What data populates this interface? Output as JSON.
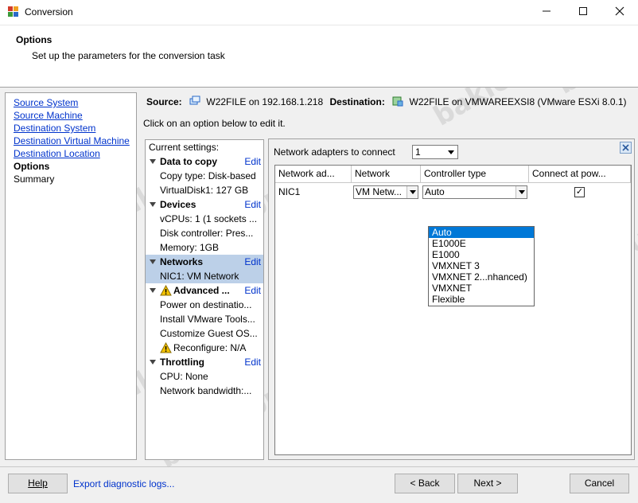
{
  "window": {
    "title": "Conversion"
  },
  "header": {
    "title": "Options",
    "subtitle": "Set up the parameters for the conversion task"
  },
  "nav": {
    "items": [
      {
        "label": "Source System",
        "state": "link"
      },
      {
        "label": "Source Machine",
        "state": "link"
      },
      {
        "label": "Destination System",
        "state": "link"
      },
      {
        "label": "Destination Virtual Machine",
        "state": "link"
      },
      {
        "label": "Destination Location",
        "state": "link"
      },
      {
        "label": "Options",
        "state": "current"
      },
      {
        "label": "Summary",
        "state": "plain"
      }
    ]
  },
  "summary": {
    "source_label": "Source:",
    "source_value": "W22FILE on 192.168.1.218",
    "dest_label": "Destination:",
    "dest_value": "W22FILE on VMWAREEXSI8 (VMware ESXi 8.0.1)"
  },
  "hint": "Click on an option below to edit it.",
  "settings": {
    "heading": "Current settings:",
    "edit_label": "Edit",
    "data_to_copy": {
      "title": "Data to copy",
      "lines": [
        "Copy type: Disk-based",
        "VirtualDisk1: 127 GB"
      ]
    },
    "devices": {
      "title": "Devices",
      "lines": [
        "vCPUs: 1 (1 sockets ...",
        "Disk controller: Pres...",
        "Memory: 1GB"
      ]
    },
    "networks": {
      "title": "Networks",
      "lines": [
        "NIC1: VM Network"
      ]
    },
    "advanced": {
      "title": "Advanced ...",
      "lines": [
        "Power on destinatio...",
        "Install VMware Tools...",
        "Customize Guest OS...",
        "Reconfigure: N/A"
      ]
    },
    "throttling": {
      "title": "Throttling",
      "lines": [
        "CPU: None",
        "Network bandwidth:..."
      ]
    }
  },
  "network_panel": {
    "adapters_label": "Network adapters to connect",
    "adapters_value": "1",
    "columns": [
      "Network ad...",
      "Network",
      "Controller type",
      "Connect at pow..."
    ],
    "row": {
      "adapter": "NIC1",
      "network": "VM Netw...",
      "controller": "Auto",
      "connect": "✓"
    },
    "controller_options": [
      "Auto",
      "E1000E",
      "E1000",
      "VMXNET 3",
      "VMXNET 2...nhanced)",
      "VMXNET",
      "Flexible"
    ]
  },
  "footer": {
    "help": "Help",
    "export": "Export diagnostic logs...",
    "back": "< Back",
    "next": "Next >",
    "cancel": "Cancel"
  },
  "watermark": "bakicubuk",
  "colors": {
    "link": "#0033cc",
    "selection": "#0078d7",
    "selected_setting": "#bcd0e8"
  }
}
